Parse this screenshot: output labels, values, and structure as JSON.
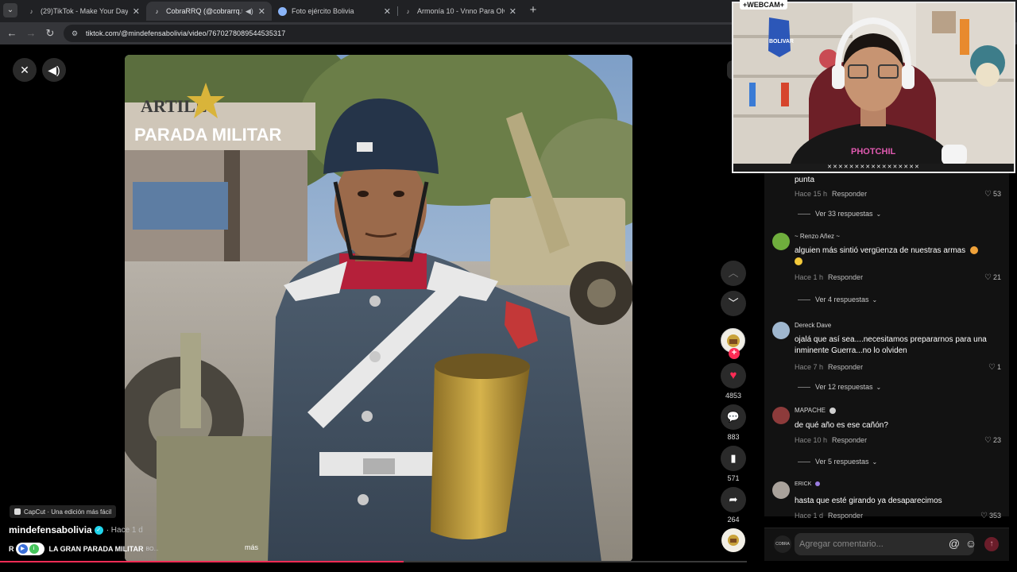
{
  "browser": {
    "tabs": [
      {
        "title": "(29)TikTok - Make Your Day",
        "icon": "tiktok-icon",
        "active": false
      },
      {
        "title": "CobraRRQ (@cobrarrq.tk) |",
        "icon": "tiktok-icon",
        "active": true,
        "audio": true
      },
      {
        "title": "Foto ejército Bolivia",
        "icon": "globe-icon",
        "active": false
      },
      {
        "title": "Armonía 10 - Vnno Para Olvida",
        "icon": "tiktok-icon",
        "active": false
      }
    ],
    "url": "tiktok.com/@mindefensabolivia/video/7670278089544535317"
  },
  "video": {
    "overlay_title": "PARADA MILITAR",
    "sign_text": "ARTILL",
    "progress_fraction": 0.54
  },
  "post": {
    "capcut_label": "CapCut · Una edición más fácil",
    "author": "mindefensabolivia",
    "time": "· Hace 1 d",
    "caption_prefix": "R",
    "caption": "LA GRAN PARADA MILITAR",
    "caption_tail": "BO...",
    "more": "más"
  },
  "actions": {
    "likes": "4853",
    "comments": "883",
    "saves": "571",
    "shares": "264"
  },
  "comments": [
    {
      "user": "",
      "text": "punta",
      "time": "Hace 15 h",
      "reply": "Responder",
      "likes": "53",
      "replies": "Ver 33 respuestas"
    },
    {
      "user": "~ Renzo Añez ~",
      "text": "alguien más sintió vergüenza de nuestras armas",
      "time": "Hace 1 h",
      "reply": "Responder",
      "likes": "21",
      "replies": "Ver 4 respuestas"
    },
    {
      "user": "Dereck Dave",
      "text": "ojalá que así sea....necesitamos prepararnos para una inminente Guerra...no lo olviden",
      "time": "Hace 7 h",
      "reply": "Responder",
      "likes": "1",
      "replies": "Ver 12 respuestas"
    },
    {
      "user": "MAPACHE",
      "text": "de qué año es ese cañón?",
      "time": "Hace 10 h",
      "reply": "Responder",
      "likes": "23",
      "replies": "Ver 5 respuestas"
    },
    {
      "user": "ERICK",
      "text": "hasta que esté girando ya desaparecimos",
      "time": "Hace 1 d",
      "reply": "Responder",
      "likes": "353",
      "replies": ""
    }
  ],
  "comment_bar": {
    "placeholder": "Agregar comentario...",
    "avatar_label": "COBRA"
  },
  "webcam": {
    "label": "+WEBCAM+",
    "strip": "✕✕✕✕✕✕✕✕✕✕✕✕✕✕✕✕✕",
    "flag_text": "BOLIVAR",
    "shirt_text": "PHOTCHIL"
  },
  "colors": {
    "accent": "#fe2c55",
    "verified": "#20d5ec",
    "panel": "#121212"
  }
}
